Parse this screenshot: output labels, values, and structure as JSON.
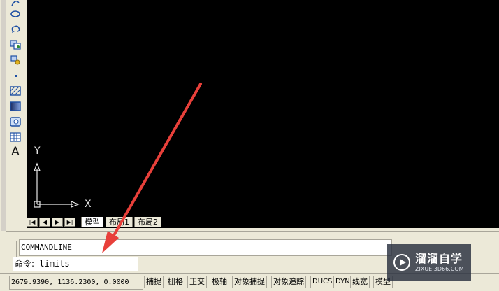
{
  "toolbar": {
    "tools": [
      "ellipse-arc-icon",
      "ellipse-icon",
      "revcloud-icon",
      "insert-block-icon",
      "make-block-icon",
      "point-icon",
      "hatch-icon",
      "gradient-icon",
      "region-icon",
      "table-icon",
      "multiline-text-icon"
    ],
    "text_tool_glyph": "A"
  },
  "canvas": {
    "background": "#000000",
    "ucs_x_label": "X",
    "ucs_y_label": "Y"
  },
  "layout_tabs": {
    "nav_first": "|◀",
    "nav_prev": "◀",
    "nav_next": "▶",
    "nav_last": "▶|",
    "tabs": [
      {
        "label": "模型",
        "active": true
      },
      {
        "label": "布局1",
        "active": false
      },
      {
        "label": "布局2",
        "active": false
      }
    ]
  },
  "command": {
    "history_text": "COMMANDLINE",
    "prompt_label": "命令:",
    "input_value": "limits",
    "highlight_color": "#e0313a"
  },
  "statusbar": {
    "coordinates": "2679.9390, 1136.2300, 0.0000",
    "toggles": [
      "捕捉",
      "栅格",
      "正交",
      "极轴",
      "对象捕捉",
      "对象追踪",
      "DUCS",
      "DYN",
      "线宽",
      "模型"
    ]
  },
  "annotation": {
    "arrow_color": "#e8403a"
  },
  "watermark": {
    "title": "溜溜自学",
    "url": "ZIXUE.3D66.COM"
  }
}
